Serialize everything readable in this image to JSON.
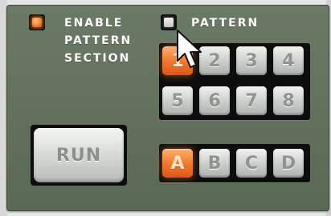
{
  "enable_pattern_section": {
    "label_lines": [
      "ENABLE",
      "PATTERN",
      "SECTION"
    ],
    "led_state": "on"
  },
  "pattern": {
    "label": "PATTERN",
    "led_state": "off"
  },
  "pattern_keys": [
    {
      "label": "1",
      "state": "on"
    },
    {
      "label": "2",
      "state": "off"
    },
    {
      "label": "3",
      "state": "off"
    },
    {
      "label": "4",
      "state": "off"
    },
    {
      "label": "5",
      "state": "off"
    },
    {
      "label": "6",
      "state": "off"
    },
    {
      "label": "7",
      "state": "off"
    },
    {
      "label": "8",
      "state": "off"
    }
  ],
  "bank_keys": [
    {
      "label": "A",
      "state": "on"
    },
    {
      "label": "B",
      "state": "off"
    },
    {
      "label": "C",
      "state": "off"
    },
    {
      "label": "D",
      "state": "off"
    }
  ],
  "run_button": {
    "label": "RUN"
  },
  "colors": {
    "panel": "#5f6e5b",
    "led_on": "#ff7a2a",
    "key_on": "#f27a2e",
    "key_off": "#c9cdc9",
    "label_text": "#ffffff"
  }
}
